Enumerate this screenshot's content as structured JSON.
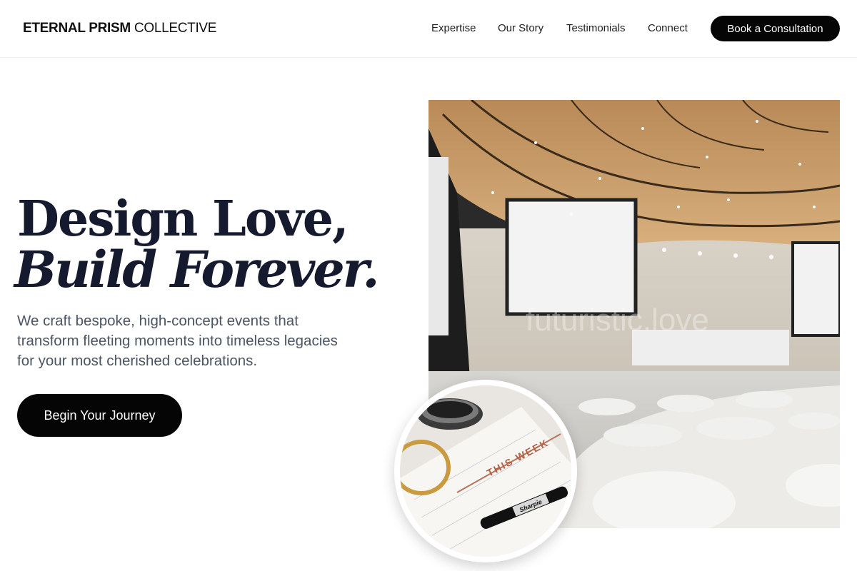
{
  "header": {
    "brand_strong": "ETERNAL PRISM",
    "brand_light": "COLLECTIVE",
    "nav": [
      "Expertise",
      "Our Story",
      "Testimonials",
      "Connect"
    ],
    "cta_label": "Book a Consultation"
  },
  "hero": {
    "headline_line1": "Design Love,",
    "headline_line2": "Build Forever.",
    "subtext": "We craft bespoke, high-concept events that transform fleeting moments into timeless legacies for your most cherished celebrations.",
    "button_label": "Begin Your Journey",
    "watermark": "futuristic.love",
    "planner_text": "THIS WEEK",
    "pen_brand": "Sharpie"
  },
  "colors": {
    "accent": "#050505",
    "headline": "#151a2e",
    "body_text": "#4b5563"
  }
}
